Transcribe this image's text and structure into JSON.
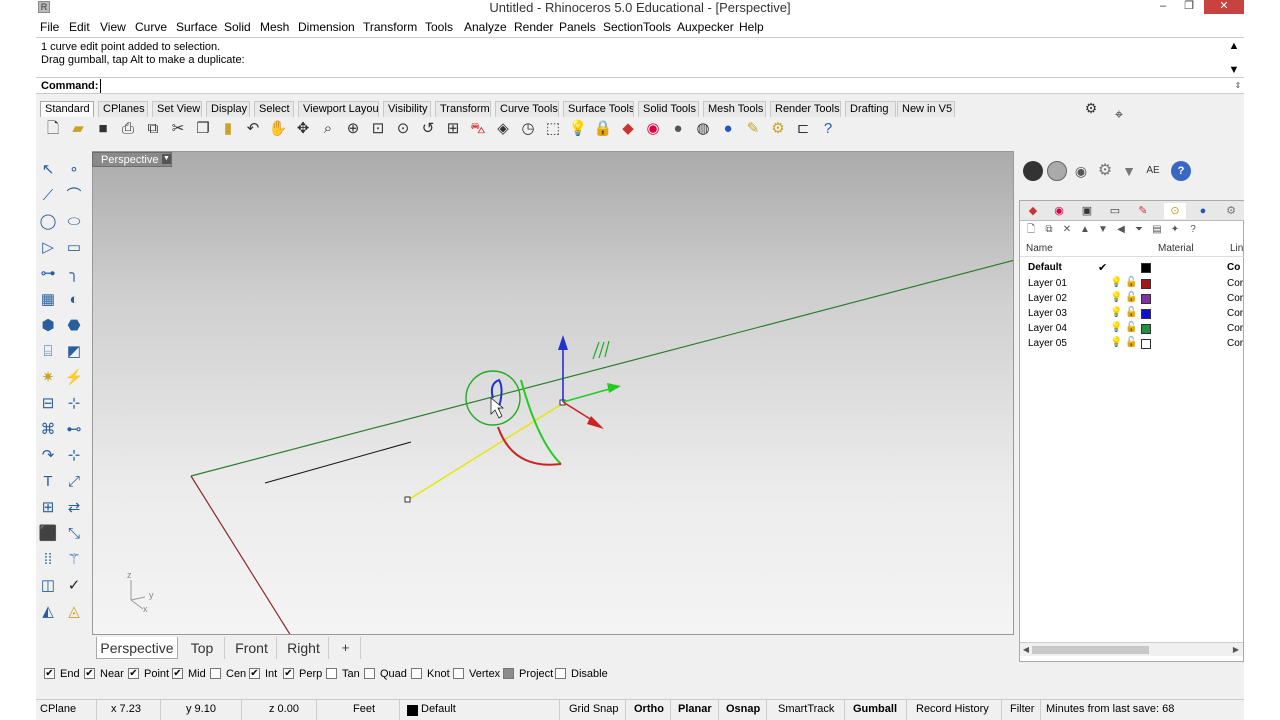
{
  "window": {
    "title": "Untitled - Rhinoceros 5.0 Educational - [Perspective]"
  },
  "menu": [
    "File",
    "Edit",
    "View",
    "Curve",
    "Surface",
    "Solid",
    "Mesh",
    "Dimension",
    "Transform",
    "Tools",
    "Analyze",
    "Render",
    "Panels",
    "SectionTools",
    "Auxpecker",
    "Help"
  ],
  "command_history": [
    "1 curve edit point added to selection.",
    "Drag gumball, tap Alt to make a duplicate:"
  ],
  "command": {
    "label": "Command:",
    "value": ""
  },
  "toolbar_tabs": [
    "Standard",
    "CPlanes",
    "Set View",
    "Display",
    "Select",
    "Viewport Layout",
    "Visibility",
    "Transform",
    "Curve Tools",
    "Surface Tools",
    "Solid Tools",
    "Mesh Tools",
    "Render Tools",
    "Drafting",
    "New in V5"
  ],
  "toolbar_icons": [
    "new-icon",
    "open-icon",
    "save-icon",
    "print-icon",
    "import-icon",
    "cut-icon",
    "copy-icon",
    "paste-icon",
    "undo-icon",
    "pan-icon",
    "rotate-icon",
    "zoom-icon",
    "zoom-window-icon",
    "zoom-extents-icon",
    "zoom-selected-icon",
    "undo-view-icon",
    "four-viewports-icon",
    "car-icon",
    "camera-icon",
    "clock-icon",
    "select-icon",
    "light-icon",
    "lock-icon",
    "render-icon",
    "color-wheel-icon",
    "sphere-icon",
    "sphere-dark-icon",
    "sphere-blue-icon",
    "paint-icon",
    "settings-icon",
    "snap-icon",
    "help-icon"
  ],
  "viewport": {
    "title": "Perspective"
  },
  "viewport_tabs": [
    "Perspective",
    "Top",
    "Front",
    "Right",
    "+"
  ],
  "osnaps": [
    {
      "label": "End",
      "checked": true
    },
    {
      "label": "Near",
      "checked": true
    },
    {
      "label": "Point",
      "checked": true
    },
    {
      "label": "Mid",
      "checked": true
    },
    {
      "label": "Cen",
      "checked": false
    },
    {
      "label": "Int",
      "checked": true
    },
    {
      "label": "Perp",
      "checked": true
    },
    {
      "label": "Tan",
      "checked": false
    },
    {
      "label": "Quad",
      "checked": false
    },
    {
      "label": "Knot",
      "checked": false
    },
    {
      "label": "Vertex",
      "checked": false
    },
    {
      "label": "Project",
      "checked": false
    },
    {
      "label": "Disable",
      "checked": false
    }
  ],
  "status": {
    "cplane": "CPlane",
    "x": "x 7.23",
    "y": "y 9.10",
    "z": "z 0.00",
    "units": "Feet",
    "layer": "Default",
    "grid_snap": "Grid Snap",
    "ortho": "Ortho",
    "planar": "Planar",
    "osnap": "Osnap",
    "smarttrack": "SmartTrack",
    "gumball": "Gumball",
    "record_history": "Record History",
    "filter": "Filter",
    "save_info": "Minutes from last save: 68"
  },
  "layers_panel": {
    "headers": {
      "name": "Name",
      "material": "Material",
      "linetype": "Lin"
    },
    "layers": [
      {
        "name": "Default",
        "current": true,
        "color": "#000000",
        "linetype": "Co"
      },
      {
        "name": "Layer 01",
        "current": false,
        "color": "#a01818",
        "linetype": "Cor"
      },
      {
        "name": "Layer 02",
        "current": false,
        "color": "#8030a0",
        "linetype": "Cor"
      },
      {
        "name": "Layer 03",
        "current": false,
        "color": "#1010d0",
        "linetype": "Cor"
      },
      {
        "name": "Layer 04",
        "current": false,
        "color": "#209040",
        "linetype": "Cor"
      },
      {
        "name": "Layer 05",
        "current": false,
        "color": "#ffffff",
        "linetype": "Cor"
      }
    ]
  },
  "right_panel_icons": {
    "ae_label": "AE"
  },
  "axis_labels": {
    "z": "z",
    "y": "y",
    "x": "x"
  }
}
